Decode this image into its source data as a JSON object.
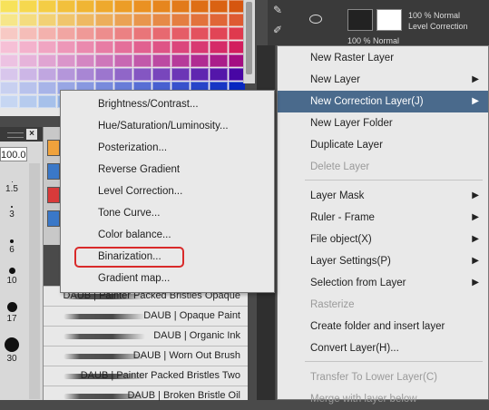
{
  "palette": {
    "colors": [
      [
        "#f7e25a",
        "#f6d84f",
        "#f4cd45",
        "#f2c03c",
        "#f0b534",
        "#eea92d",
        "#ec9d27",
        "#ea9122",
        "#e6861e",
        "#e27a1a",
        "#de6e16",
        "#da6212",
        "#d6560f"
      ],
      [
        "#f6e68a",
        "#f4dc7f",
        "#f2d175",
        "#f0c56c",
        "#eeb963",
        "#ecae5b",
        "#eaa254",
        "#e8964d",
        "#e68a47",
        "#e47e41",
        "#e2723c",
        "#e06637",
        "#de5a32"
      ],
      [
        "#f7c9c4",
        "#f5bdb8",
        "#f3b1ad",
        "#f1a5a2",
        "#ef9997",
        "#ed8d8d",
        "#eb8183",
        "#e97579",
        "#e76970",
        "#e55d67",
        "#e3515e",
        "#e14556",
        "#df394e"
      ],
      [
        "#f6c0d6",
        "#f3b2cc",
        "#f0a5c2",
        "#ed97b8",
        "#ea8aae",
        "#e77ca4",
        "#e46f9a",
        "#e16190",
        "#de5486",
        "#db467c",
        "#d83972",
        "#d52b68",
        "#d21e5e"
      ],
      [
        "#ecc2e2",
        "#e6b3da",
        "#e0a4d2",
        "#da95ca",
        "#d486c2",
        "#ce77ba",
        "#c868b2",
        "#c259aa",
        "#bc4aa2",
        "#b63b9a",
        "#b02c92",
        "#aa1d8a",
        "#a40e82"
      ],
      [
        "#d8c6ec",
        "#ccb6e6",
        "#c0a6e0",
        "#b496da",
        "#a886d4",
        "#9c76ce",
        "#9066c8",
        "#8456c2",
        "#7846bc",
        "#6c36b6",
        "#6026b0",
        "#5416aa",
        "#4806a4"
      ],
      [
        "#c8d0f0",
        "#b8c2ec",
        "#a8b4e8",
        "#98a6e4",
        "#8898e0",
        "#788adc",
        "#687cd8",
        "#586ed4",
        "#4860d0",
        "#3852cc",
        "#2844c8",
        "#1836c4",
        "#0828c0"
      ],
      [
        "#c6d6f2",
        "#b6cbee",
        "#a6c0ea",
        "#96b5e6",
        "#86aae2",
        "#769fde",
        "#6694da",
        "#5689d6",
        "#467ed2",
        "#3673ce",
        "#2668ca",
        "#165dc6",
        "#0652c2"
      ]
    ]
  },
  "brush_size": {
    "value": "100.0",
    "sizes": [
      "1.5",
      "3",
      "6",
      "10",
      "17",
      "30"
    ]
  },
  "brush_list": {
    "items": [
      "DAUB | Painter Packed Bristles Opaque",
      "DAUB | Opaque Paint",
      "DAUB | Organic Ink",
      "DAUB | Worn Out Brush",
      "DAUB | Painter Packed Bristles Two",
      "DAUB | Broken Bristle Oil"
    ]
  },
  "layers": {
    "top_layer": {
      "mode": "100 % Normal",
      "name": "Level Correction"
    },
    "second_layer": {
      "mode": "100 % Normal"
    }
  },
  "context_menu": {
    "items": [
      {
        "label": "New Raster Layer",
        "arrow": false,
        "disabled": false,
        "highlight": false
      },
      {
        "label": "New Layer",
        "arrow": true,
        "disabled": false,
        "highlight": false
      },
      {
        "label": "New Correction Layer(J)",
        "arrow": true,
        "disabled": false,
        "highlight": true
      },
      {
        "label": "New Layer Folder",
        "arrow": false,
        "disabled": false,
        "highlight": false
      },
      {
        "label": "Duplicate Layer",
        "arrow": false,
        "disabled": false,
        "highlight": false
      },
      {
        "label": "Delete Layer",
        "arrow": false,
        "disabled": true,
        "highlight": false
      },
      {
        "label": "Layer Mask",
        "arrow": true,
        "disabled": false,
        "highlight": false
      },
      {
        "label": "Ruler - Frame",
        "arrow": true,
        "disabled": false,
        "highlight": false
      },
      {
        "label": "File object(X)",
        "arrow": true,
        "disabled": false,
        "highlight": false
      },
      {
        "label": "Layer Settings(P)",
        "arrow": true,
        "disabled": false,
        "highlight": false
      },
      {
        "label": "Selection from Layer",
        "arrow": true,
        "disabled": false,
        "highlight": false
      },
      {
        "label": "Rasterize",
        "arrow": false,
        "disabled": true,
        "highlight": false
      },
      {
        "label": "Create folder and insert layer",
        "arrow": false,
        "disabled": false,
        "highlight": false
      },
      {
        "label": "Convert Layer(H)...",
        "arrow": false,
        "disabled": false,
        "highlight": false
      },
      {
        "label": "Transfer To Lower Layer(C)",
        "arrow": false,
        "disabled": true,
        "highlight": false
      },
      {
        "label": "Merge with layer below",
        "arrow": false,
        "disabled": true,
        "highlight": false
      }
    ]
  },
  "correction_submenu": {
    "items": [
      "Brightness/Contrast...",
      "Hue/Saturation/Luminosity...",
      "Posterization...",
      "Reverse Gradient",
      "Level Correction...",
      "Tone Curve...",
      "Color balance...",
      "Binarization...",
      "Gradient map..."
    ],
    "highlighted": "Binarization...",
    "highlight_color": "#d92a2a"
  },
  "colors": {
    "menu_bg": "#e9e9e9",
    "menu_highlight": "#4a6a8c",
    "panel_dark": "#3a3a3a"
  }
}
